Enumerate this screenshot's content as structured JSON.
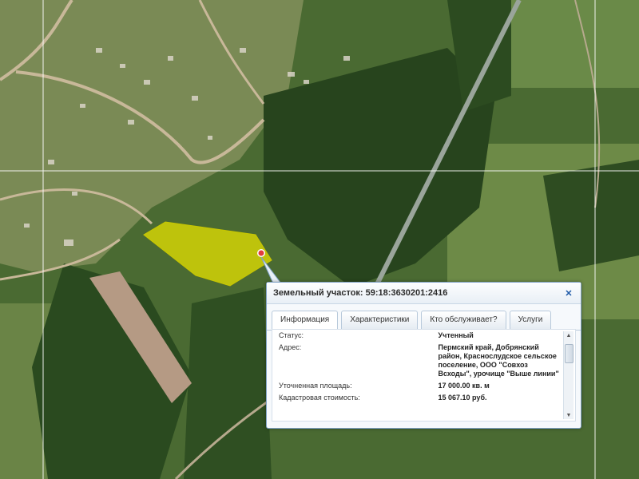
{
  "map": {
    "colors": {
      "forest": "#2d4a22",
      "field": "#6f8a4b",
      "bare": "#b99b86",
      "road": "#c9b79a",
      "parcel": "#e6e200",
      "marker": "#e23b3b",
      "grid": "#ffffff"
    },
    "marker_icon": "map-pin-icon"
  },
  "popup": {
    "title": "Земельный участок: 59:18:3630201:2416",
    "close_icon": "close-icon",
    "tabs": [
      {
        "label": "Информация",
        "active": true
      },
      {
        "label": "Характеристики",
        "active": false
      },
      {
        "label": "Кто обслуживает?",
        "active": false
      },
      {
        "label": "Услуги",
        "active": false
      }
    ],
    "rows": [
      {
        "label": "Статус:",
        "value": "Учтенный"
      },
      {
        "label": "Адрес:",
        "value": "Пермский край, Добрянский район, Краснослудское сельское поселение, ООО \"Совхоз Всходы\", урочище \"Выше линии\""
      },
      {
        "label": "Уточненная площадь:",
        "value": "17 000.00 кв. м"
      },
      {
        "label": "Кадастровая стоимость:",
        "value": "15 067.10 руб."
      }
    ]
  }
}
